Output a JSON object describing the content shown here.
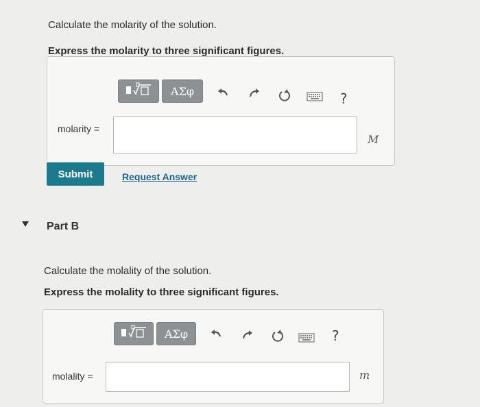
{
  "part_a": {
    "question": "Calculate the molarity of the solution.",
    "instruction": "Express the molarity to three significant figures.",
    "toolbar": {
      "greek_label": "ΑΣφ",
      "help_label": "?"
    },
    "input_label": "molarity =",
    "input_value": "",
    "unit": "M",
    "submit_label": "Submit",
    "request_answer_label": "Request Answer"
  },
  "part_b": {
    "title": "Part B",
    "question": "Calculate the molality of the solution.",
    "instruction": "Express the molality to three significant figures.",
    "toolbar": {
      "greek_label": "ΑΣφ",
      "help_label": "?"
    },
    "input_label": "molality =",
    "input_value": "",
    "unit": "m"
  },
  "colors": {
    "background": "#eeeeec",
    "toolbar_button": "#8e9194",
    "submit": "#1c7a8f",
    "link": "#1f6690"
  },
  "icons": [
    "templates-icon",
    "undo-icon",
    "redo-icon",
    "reset-icon",
    "keyboard-icon",
    "help-icon",
    "collapse-triangle-icon"
  ]
}
